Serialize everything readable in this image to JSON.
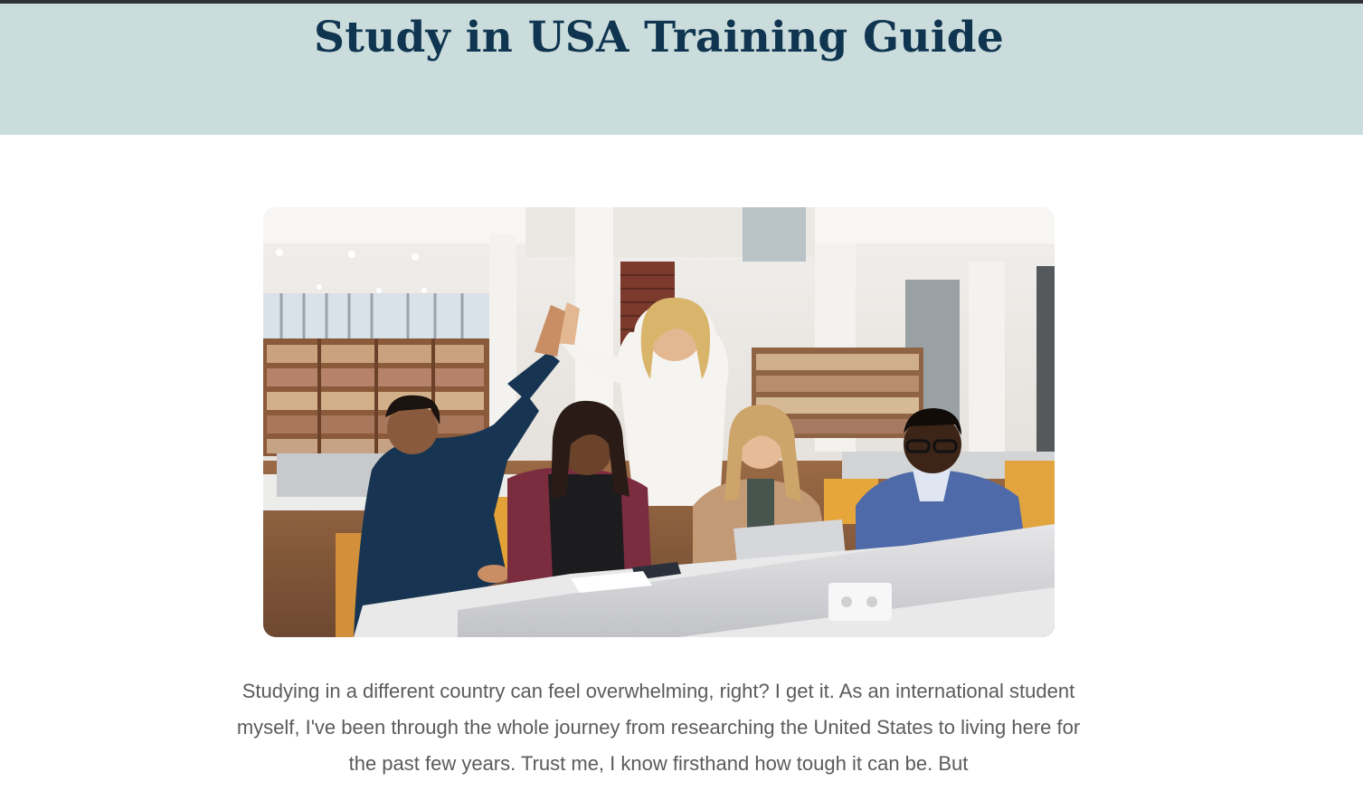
{
  "page": {
    "title": "Study in USA Training Guide",
    "intro_text": "Studying in a different country can feel overwhelming, right? I get it. As an international student myself, I've been through the whole journey from researching the United States to living here for the past few years. Trust me, I know firsthand how tough it can be. But"
  },
  "hero": {
    "background_color": "#cbdcdc",
    "title_color": "#0f3550"
  },
  "featured_image": {
    "subject": "five students and a teacher giving a high five at library desks"
  }
}
